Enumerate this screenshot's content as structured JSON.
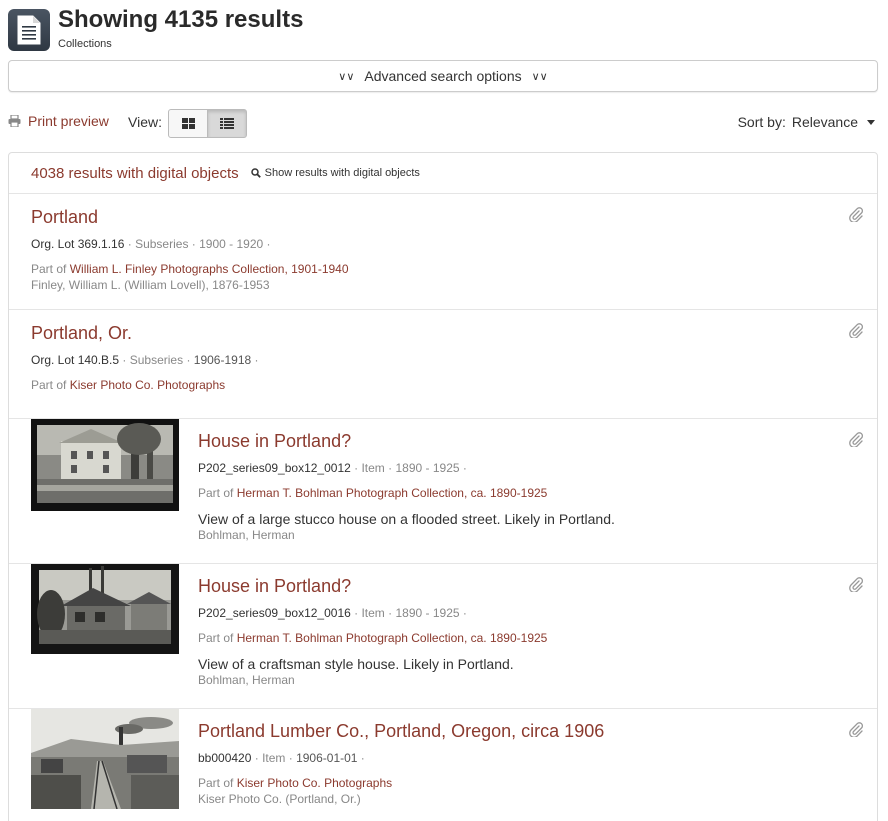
{
  "header": {
    "title": "Showing 4135 results",
    "subtitle": "Collections",
    "icon": "document-icon"
  },
  "advanced": {
    "label": "Advanced search options"
  },
  "toolbar": {
    "print_label": "Print preview",
    "view_label": "View:",
    "sort_label": "Sort by:",
    "sort_value": "Relevance"
  },
  "digital": {
    "count_label": "4038 results with digital objects",
    "show_label": "Show results with digital objects"
  },
  "colors": {
    "link": "#8b3a2e",
    "muted": "#888888"
  },
  "results": [
    {
      "title": "Portland",
      "identifier": "Org. Lot 369.1.16",
      "level": "Subseries",
      "dates": "1900 - 1920",
      "part_prefix": "Part of",
      "part_of": "William L. Finley Photographs Collection, 1901-1940",
      "creator": "Finley, William L. (William Lovell), 1876-1953"
    },
    {
      "title": "Portland, Or.",
      "identifier": "Org. Lot 140.B.5",
      "level": "Subseries",
      "dates": "1906-1918",
      "part_prefix": "Part of",
      "part_of": "Kiser Photo Co. Photographs"
    },
    {
      "title": "House in Portland?",
      "identifier": "P202_series09_box12_0012",
      "level": "Item",
      "dates": "1890 - 1925",
      "part_prefix": "Part of",
      "part_of": "Herman T. Bohlman Photograph Collection, ca. 1890-1925",
      "description": "View of a large stucco house on a flooded street. Likely in Portland.",
      "creator": "Bohlman, Herman"
    },
    {
      "title": "House in Portland?",
      "identifier": "P202_series09_box12_0016",
      "level": "Item",
      "dates": "1890 - 1925",
      "part_prefix": "Part of",
      "part_of": "Herman T. Bohlman Photograph Collection, ca. 1890-1925",
      "description": "View of a craftsman style house. Likely in Portland.",
      "creator": "Bohlman, Herman"
    },
    {
      "title": "Portland Lumber Co., Portland, Oregon, circa 1906",
      "identifier": "bb000420",
      "level": "Item",
      "dates": "1906-01-01",
      "part_prefix": "Part of",
      "part_of": "Kiser Photo Co. Photographs",
      "creator": "Kiser Photo Co. (Portland, Or.)"
    }
  ]
}
